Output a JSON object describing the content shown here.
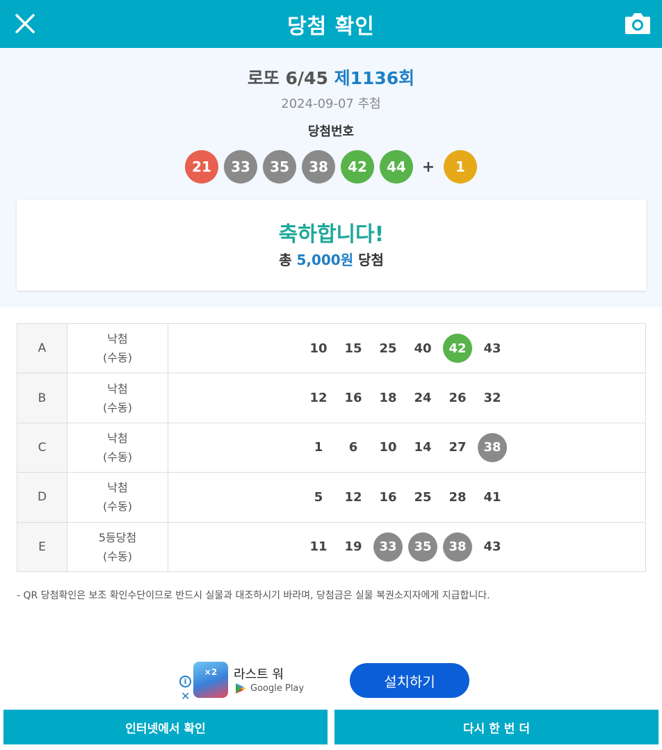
{
  "header": {
    "title": "당첨 확인",
    "close_icon": "close-icon",
    "camera_icon": "camera-icon"
  },
  "draw": {
    "game": "로또 6/45",
    "round": "제1136회",
    "date": "2024-09-07 추첨",
    "label": "당첨번호",
    "numbers": [
      "21",
      "33",
      "35",
      "38",
      "42",
      "44"
    ],
    "number_colors": [
      "#e8604f",
      "#8a8a8a",
      "#8a8a8a",
      "#8a8a8a",
      "#57b34a",
      "#57b34a"
    ],
    "plus": "+",
    "bonus": "1",
    "bonus_color": "#e6a91a"
  },
  "result": {
    "congrats": "축하합니다!",
    "total_prefix": "총",
    "total_amount": "5,000원",
    "total_suffix": "당첨"
  },
  "tickets": [
    {
      "slot": "A",
      "rank": "낙첨",
      "mode": "(수동)",
      "numbers": [
        "10",
        "15",
        "25",
        "40",
        "42",
        "43"
      ],
      "hits": [
        false,
        false,
        false,
        false,
        true,
        false
      ],
      "hit_colors": [
        "",
        "",
        "",
        "",
        "#57b34a",
        ""
      ]
    },
    {
      "slot": "B",
      "rank": "낙첨",
      "mode": "(수동)",
      "numbers": [
        "12",
        "16",
        "18",
        "24",
        "26",
        "32"
      ],
      "hits": [
        false,
        false,
        false,
        false,
        false,
        false
      ],
      "hit_colors": [
        "",
        "",
        "",
        "",
        "",
        ""
      ]
    },
    {
      "slot": "C",
      "rank": "낙첨",
      "mode": "(수동)",
      "numbers": [
        "1",
        "6",
        "10",
        "14",
        "27",
        "38"
      ],
      "hits": [
        false,
        false,
        false,
        false,
        false,
        true
      ],
      "hit_colors": [
        "",
        "",
        "",
        "",
        "",
        "#8a8a8a"
      ]
    },
    {
      "slot": "D",
      "rank": "낙첨",
      "mode": "(수동)",
      "numbers": [
        "5",
        "12",
        "16",
        "25",
        "28",
        "41"
      ],
      "hits": [
        false,
        false,
        false,
        false,
        false,
        false
      ],
      "hit_colors": [
        "",
        "",
        "",
        "",
        "",
        ""
      ]
    },
    {
      "slot": "E",
      "rank": "5등당첨",
      "mode": "(수동)",
      "numbers": [
        "11",
        "19",
        "33",
        "35",
        "38",
        "43"
      ],
      "hits": [
        false,
        false,
        true,
        true,
        true,
        false
      ],
      "hit_colors": [
        "",
        "",
        "#8a8a8a",
        "#8a8a8a",
        "#8a8a8a",
        ""
      ]
    }
  ],
  "notice": "- QR 당첨확인은 보조 확인수단이므로 반드시 실물과 대조하시기 바라며, 당첨금은 실물 복권소지자에게 지급합니다.",
  "ad": {
    "info_icon": "info-icon",
    "close_icon": "close-icon",
    "app_icon_text": "×2",
    "app_name": "라스트 워",
    "store": "Google Play",
    "install_label": "설치하기"
  },
  "buttons": {
    "check_online": "인터넷에서 확인",
    "again": "다시 한 번 더"
  }
}
